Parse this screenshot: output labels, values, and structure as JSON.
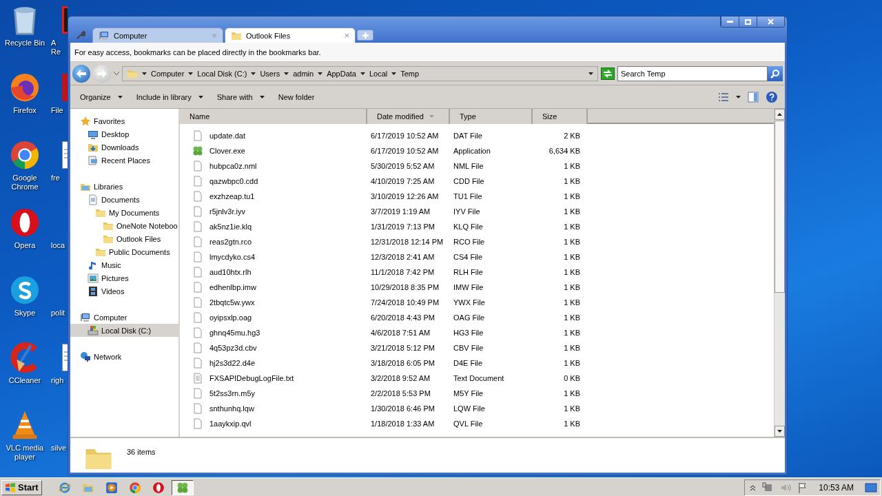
{
  "desktop": {
    "icons": [
      {
        "label": "Recycle Bin",
        "kind": "recycle"
      },
      {
        "label": "Firefox",
        "kind": "firefox"
      },
      {
        "label": "Google Chrome",
        "kind": "chrome"
      },
      {
        "label": "Opera",
        "kind": "opera"
      },
      {
        "label": "Skype",
        "kind": "skype"
      },
      {
        "label": "CCleaner",
        "kind": "ccleaner"
      },
      {
        "label": "VLC media player",
        "kind": "vlc"
      }
    ],
    "column_2": [
      {
        "label": "A Re",
        "kind": "dark"
      },
      {
        "label": "File",
        "kind": "red"
      },
      {
        "label": "fre",
        "kind": "doc"
      },
      {
        "label": "loca",
        "kind": "none"
      },
      {
        "label": "polit",
        "kind": "none"
      },
      {
        "label": "righ",
        "kind": "doc"
      },
      {
        "label": "silve",
        "kind": "none"
      }
    ]
  },
  "window": {
    "tabs": [
      {
        "label": "Computer",
        "kind": "computer",
        "selected": false,
        "close": "×"
      },
      {
        "label": "Outlook Files",
        "kind": "folder",
        "selected": true,
        "close": "×"
      }
    ],
    "bookmark_hint": "For easy access, bookmarks can be placed directly in the bookmarks bar.",
    "breadcrumb": [
      "Computer",
      "Local Disk (C:)",
      "Users",
      "admin",
      "AppData",
      "Local",
      "Temp"
    ],
    "search": {
      "placeholder": "Search Temp"
    },
    "toolbar": [
      {
        "label": "Organize",
        "menu": true
      },
      {
        "label": "Include in library",
        "menu": true
      },
      {
        "label": "Share with",
        "menu": true
      },
      {
        "label": "New folder",
        "menu": false
      }
    ],
    "nav": [
      {
        "label": "Favorites",
        "kind": "star",
        "selected": false,
        "children": [
          {
            "label": "Desktop",
            "kind": "desktop",
            "selected": false
          },
          {
            "label": "Downloads",
            "kind": "downloads",
            "selected": false
          },
          {
            "label": "Recent Places",
            "kind": "recent",
            "selected": false
          }
        ]
      },
      {
        "label": "Libraries",
        "kind": "library",
        "selected": false,
        "children": [
          {
            "label": "Documents",
            "kind": "document",
            "selected": false,
            "children": [
              {
                "label": "My Documents",
                "kind": "folder",
                "selected": false,
                "children": [
                  {
                    "label": "OneNote Noteboo",
                    "kind": "folder",
                    "selected": false
                  },
                  {
                    "label": "Outlook Files",
                    "kind": "folder",
                    "selected": false
                  }
                ]
              },
              {
                "label": "Public Documents",
                "kind": "folder",
                "selected": false
              }
            ]
          },
          {
            "label": "Music",
            "kind": "music",
            "selected": false
          },
          {
            "label": "Pictures",
            "kind": "pictures",
            "selected": false
          },
          {
            "label": "Videos",
            "kind": "videos",
            "selected": false
          }
        ]
      },
      {
        "label": "Computer",
        "kind": "computer",
        "selected": false,
        "children": [
          {
            "label": "Local Disk (C:)",
            "kind": "disk",
            "selected": true
          }
        ]
      },
      {
        "label": "Network",
        "kind": "network",
        "selected": false
      }
    ],
    "table": {
      "columns": [
        {
          "label": "Name",
          "sorted": false
        },
        {
          "label": "Date modified",
          "sorted": true
        },
        {
          "label": "Type",
          "sorted": false
        },
        {
          "label": "Size",
          "sorted": false
        }
      ],
      "rows": [
        {
          "kind": "file",
          "name": "update.dat",
          "date": "6/17/2019 10:52 AM",
          "type": "DAT File",
          "size": "2 KB"
        },
        {
          "kind": "app",
          "name": "Clover.exe",
          "date": "6/17/2019 10:52 AM",
          "type": "Application",
          "size": "6,634 KB"
        },
        {
          "kind": "file",
          "name": "hubpca0z.nml",
          "date": "5/30/2019 5:52 AM",
          "type": "NML File",
          "size": "1 KB"
        },
        {
          "kind": "file",
          "name": "qazwbpc0.cdd",
          "date": "4/10/2019 7:25 AM",
          "type": "CDD File",
          "size": "1 KB"
        },
        {
          "kind": "file",
          "name": "exzhzeap.tu1",
          "date": "3/10/2019 12:26 AM",
          "type": "TU1 File",
          "size": "1 KB"
        },
        {
          "kind": "file",
          "name": "r5jnlv3r.iyv",
          "date": "3/7/2019 1:19 AM",
          "type": "IYV File",
          "size": "1 KB"
        },
        {
          "kind": "file",
          "name": "ak5nz1ie.klq",
          "date": "1/31/2019 7:13 PM",
          "type": "KLQ File",
          "size": "1 KB"
        },
        {
          "kind": "file",
          "name": "reas2gtn.rco",
          "date": "12/31/2018 12:14 PM",
          "type": "RCO File",
          "size": "1 KB"
        },
        {
          "kind": "file",
          "name": "lmycdyko.cs4",
          "date": "12/3/2018 2:41 AM",
          "type": "CS4 File",
          "size": "1 KB"
        },
        {
          "kind": "file",
          "name": "aud10htx.rlh",
          "date": "11/1/2018 7:42 PM",
          "type": "RLH File",
          "size": "1 KB"
        },
        {
          "kind": "file",
          "name": "edhenlbp.imw",
          "date": "10/29/2018 8:35 PM",
          "type": "IMW File",
          "size": "1 KB"
        },
        {
          "kind": "file",
          "name": "2tbqtc5w.ywx",
          "date": "7/24/2018 10:49 PM",
          "type": "YWX File",
          "size": "1 KB"
        },
        {
          "kind": "file",
          "name": "oyipsxlp.oag",
          "date": "6/20/2018 4:43 PM",
          "type": "OAG File",
          "size": "1 KB"
        },
        {
          "kind": "file",
          "name": "ghnq45mu.hg3",
          "date": "4/6/2018 7:51 AM",
          "type": "HG3 File",
          "size": "1 KB"
        },
        {
          "kind": "file",
          "name": "4q53pz3d.cbv",
          "date": "3/21/2018 5:12 PM",
          "type": "CBV File",
          "size": "1 KB"
        },
        {
          "kind": "file",
          "name": "hj2s3d22.d4e",
          "date": "3/18/2018 6:05 PM",
          "type": "D4E File",
          "size": "1 KB"
        },
        {
          "kind": "text",
          "name": "FXSAPIDebugLogFile.txt",
          "date": "3/2/2018 9:52 AM",
          "type": "Text Document",
          "size": "0 KB"
        },
        {
          "kind": "file",
          "name": "5t2ss3rn.m5y",
          "date": "2/2/2018 5:53 PM",
          "type": "M5Y File",
          "size": "1 KB"
        },
        {
          "kind": "file",
          "name": "snthunhq.lqw",
          "date": "1/30/2018 6:46 PM",
          "type": "LQW File",
          "size": "1 KB"
        },
        {
          "kind": "file",
          "name": "1aaykxip.qvl",
          "date": "1/18/2018 1:33 AM",
          "type": "QVL File",
          "size": "1 KB"
        }
      ]
    },
    "status": "36 items"
  },
  "taskbar": {
    "start": "Start",
    "apps": [
      {
        "kind": "ie",
        "selected": false
      },
      {
        "kind": "explorer",
        "selected": false
      },
      {
        "kind": "media",
        "selected": false
      },
      {
        "kind": "chrome",
        "selected": false
      },
      {
        "kind": "opera",
        "selected": false
      },
      {
        "kind": "clover",
        "selected": true
      }
    ],
    "clock": "10:53 AM"
  }
}
